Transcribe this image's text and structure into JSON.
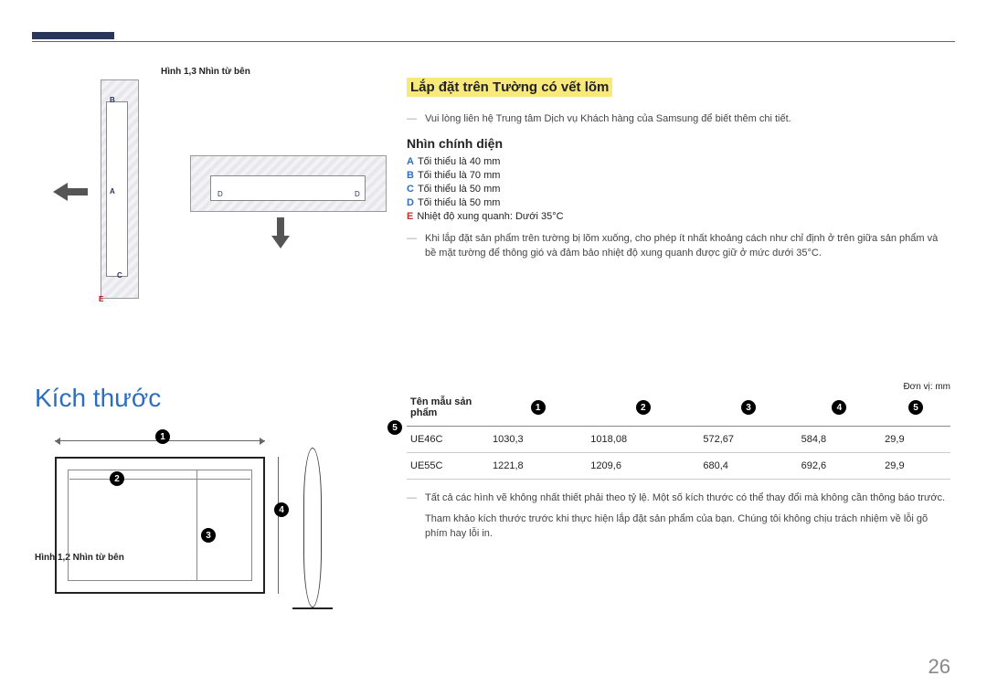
{
  "figures": {
    "side_label": "Hình 1,3 Nhìn từ bên",
    "top_label_below": "Hình 1,2 Nhìn từ bên",
    "A": "A",
    "B": "B",
    "C": "C",
    "D": "D",
    "E": "E"
  },
  "wall_section": {
    "title": "Lắp đặt trên Tường có vết lõm",
    "contact_note": "Vui lòng liên hệ Trung tâm Dịch vụ Khách hàng của Samsung để biết thêm chi tiết.",
    "front_view_heading": "Nhìn chính diện",
    "specs": {
      "A": "Tối thiểu là 40 mm",
      "B": "Tối thiểu là 70 mm",
      "C": "Tối thiểu là 50 mm",
      "D": "Tối thiểu là 50 mm",
      "E": "Nhiệt độ xung quanh: Dưới 35°C"
    },
    "indent_note": "Khi lắp đặt sản phẩm trên tường bị lõm xuống, cho phép ít nhất khoảng cách như chỉ định ở trên giữa sản phẩm và bề mặt tường để thông gió và đảm bảo nhiệt độ xung quanh được giữ ở mức dưới 35°C."
  },
  "dimensions": {
    "heading": "Kích thước",
    "unit": "Đơn vị: mm",
    "col_model": "Tên mẫu sản phẩm",
    "nums": [
      "1",
      "2",
      "3",
      "4",
      "5"
    ],
    "rows": [
      {
        "model": "UE46C",
        "v": [
          "1030,3",
          "1018,08",
          "572,67",
          "584,8",
          "29,9"
        ]
      },
      {
        "model": "UE55C",
        "v": [
          "1221,8",
          "1209,6",
          "680,4",
          "692,6",
          "29,9"
        ]
      }
    ],
    "note1": "Tất cả các hình vẽ không nhất thiết phải theo tỷ lệ. Một số kích thước có thể thay đổi mà không cần thông báo trước.",
    "note2": "Tham khảo kích thước trước khi thực hiện lắp đặt sản phẩm của bạn. Chúng tôi không chịu trách nhiệm về lỗi gõ phím hay lỗi in."
  },
  "page": "26"
}
